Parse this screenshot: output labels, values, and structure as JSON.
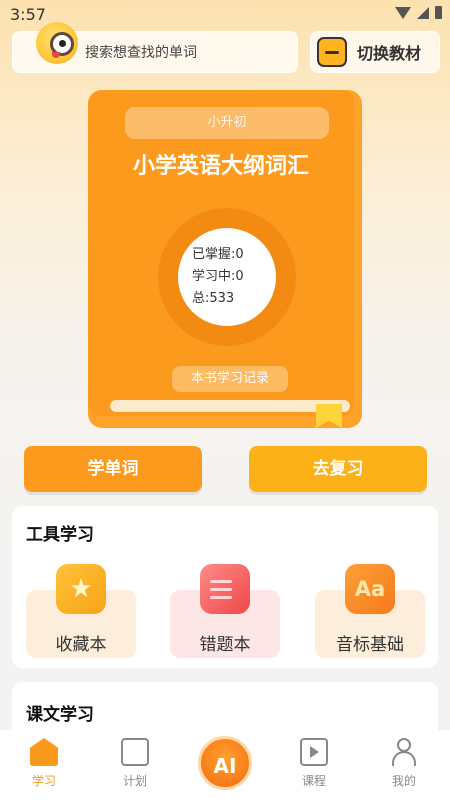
{
  "status_bar": {
    "time": "3:57"
  },
  "search": {
    "placeholder": "搜索想查找的单词"
  },
  "switch_textbook": {
    "label": "切换教材"
  },
  "book": {
    "level": "小升初",
    "title": "小学英语大纲词汇",
    "mastered": "已掌握:0",
    "learning": "学习中:0",
    "total": "总:533",
    "record_label": "本书学习记录",
    "progress": 0
  },
  "actions": {
    "learn_words": "学单词",
    "review": "去复习"
  },
  "tools": {
    "title": "工具学习",
    "items": [
      {
        "label": "收藏本",
        "icon": "star-icon"
      },
      {
        "label": "错题本",
        "icon": "notebook-icon"
      },
      {
        "label": "音标基础",
        "icon": "aa-phonics-icon",
        "glyph": "Aa"
      }
    ]
  },
  "lessons": {
    "title": "课文学习"
  },
  "tabbar": {
    "study": "学习",
    "plan": "计划",
    "ai": "AI",
    "course": "课程",
    "mine": "我的"
  },
  "colors": {
    "primary": "#fb9a1c",
    "secondary": "#fdb119",
    "accent_red": "#f04848"
  }
}
